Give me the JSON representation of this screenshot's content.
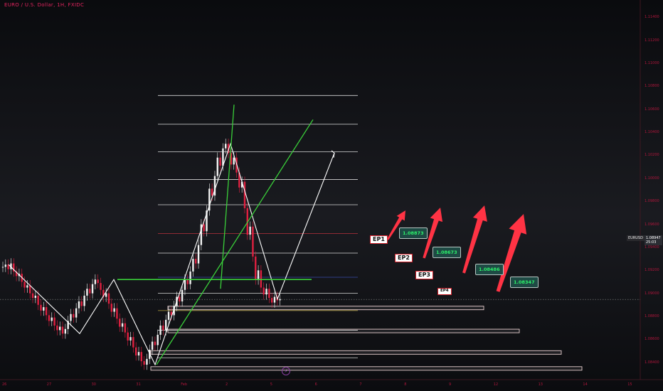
{
  "header": {
    "title": "EURO / U.S. Dollar, 1H, FXIDC"
  },
  "price_badge": {
    "symbol": "EURUSD",
    "price": "1.08947",
    "countdown": "25:03"
  },
  "colors": {
    "background": "#0c0d10",
    "candle_up": "#f2f2f2",
    "candle_down": "#e02040",
    "zigzag": "#ffffff",
    "trend_line": "#3ad03a",
    "arrow": "#ff3344",
    "axis_text": "#b0163c"
  },
  "chart_data": {
    "type": "candlestick",
    "title": "EURO / U.S. Dollar, 1H, FXIDC",
    "x_ticks": [
      "26",
      "27",
      "30",
      "31",
      "Feb",
      "2",
      "5",
      "6",
      "7",
      "8",
      "9",
      "12",
      "13",
      "14",
      "15"
    ],
    "y_ticks": [
      "1.08400",
      "1.08600",
      "1.08800",
      "1.09000",
      "1.09200",
      "1.09400",
      "1.09600",
      "1.09800",
      "1.10000",
      "1.10200",
      "1.10400",
      "1.10600",
      "1.10800",
      "1.11000",
      "1.11200",
      "1.11400"
    ],
    "ylim": [
      1.0825,
      1.1155
    ],
    "grid": false,
    "last_price": 1.08947,
    "fib_levels": [
      1.0844,
      1.0868,
      1.0885,
      1.09,
      1.0914,
      1.0935,
      1.0952,
      1.0977,
      1.0999,
      1.1023,
      1.1047,
      1.1072
    ],
    "green_hline": 1.0912,
    "entry_points": [
      {
        "label": "EP1",
        "price": "1.08873",
        "value": 1.08873
      },
      {
        "label": "EP2",
        "price": "1.08673",
        "value": 1.08673
      },
      {
        "label": "EP3",
        "price": "1.08486",
        "value": 1.08486
      },
      {
        "label": "EP4",
        "price": "1.08347",
        "value": 1.08347
      }
    ],
    "zigzag_path": [
      1.0925,
      1.0865,
      1.0912,
      1.0838,
      1.103,
      1.0895,
      1.1022
    ],
    "series": [
      {
        "values": [
          1.0923,
          1.0925,
          1.0921,
          1.0926,
          1.0919,
          1.0915,
          1.0917,
          1.091,
          1.0905,
          1.0907,
          1.09,
          1.0896,
          1.0898,
          1.089,
          1.0885,
          1.0888,
          1.0881,
          1.0876,
          1.0879,
          1.0872,
          1.0868,
          1.0871,
          1.0865,
          1.0869,
          1.0876,
          1.0882,
          1.0879,
          1.0887,
          1.0893,
          1.0889,
          1.0898,
          1.0904,
          1.09,
          1.0908,
          1.0912,
          1.0909,
          1.0903,
          1.0897,
          1.09,
          1.0891,
          1.0884,
          1.0887,
          1.0878,
          1.0871,
          1.0874,
          1.0866,
          1.0859,
          1.0862,
          1.0853,
          1.0846,
          1.0849,
          1.0841,
          1.0838,
          1.0843,
          1.0851,
          1.0858,
          1.0855,
          1.0864,
          1.0872,
          1.0868,
          1.0877,
          1.0884,
          1.0881,
          1.0889,
          1.0897,
          1.0893,
          1.0903,
          1.0912,
          1.0908,
          1.0919,
          1.093,
          1.0926,
          1.0942,
          1.096,
          1.0954,
          1.0972,
          1.0991,
          1.0985,
          1.1002,
          1.1018,
          1.1011,
          1.1026,
          1.103,
          1.1022,
          1.1012,
          1.1018,
          1.1005,
          1.0992,
          1.0997,
          1.0974,
          1.0951,
          1.0958,
          1.0932,
          1.0912,
          1.092,
          1.0905,
          1.0899,
          1.0904,
          1.0896,
          1.0892,
          1.0897,
          1.0894,
          1.0895
        ]
      }
    ]
  }
}
